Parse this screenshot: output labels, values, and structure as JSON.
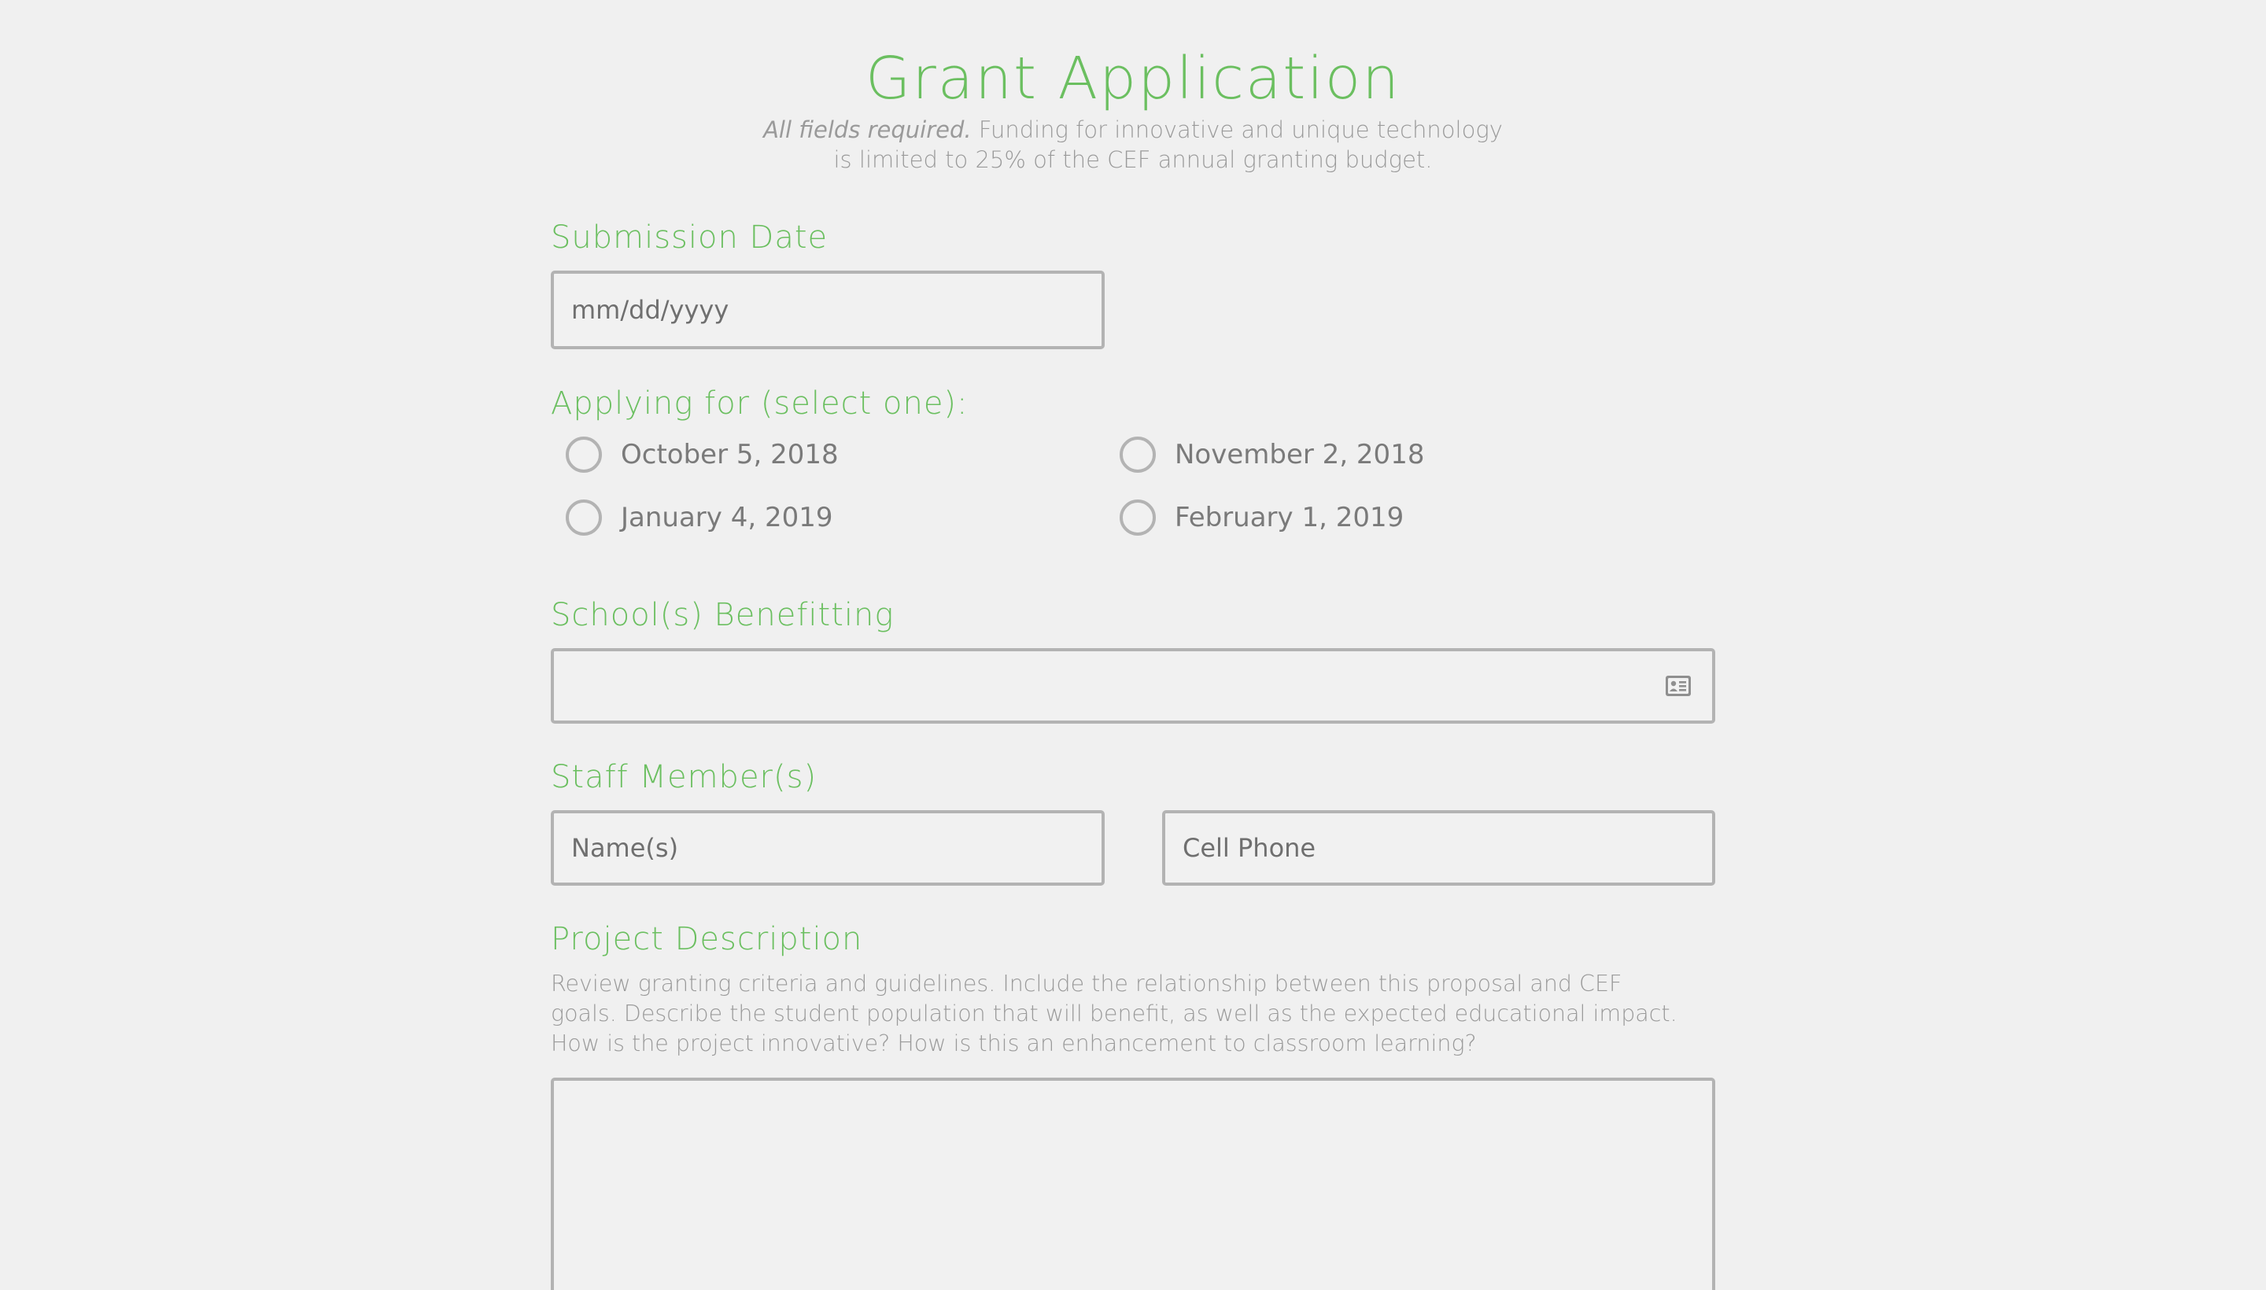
{
  "header": {
    "title": "Grant Application",
    "subtitle_required": "All fields required.",
    "subtitle_line1_rest": " Funding for innovative and unique technology",
    "subtitle_line2": "is limited to 25% of the CEF annual granting budget."
  },
  "submission_date": {
    "label": "Submission Date",
    "placeholder": "mm/dd/yyyy"
  },
  "applying_for": {
    "label": "Applying for (select one):",
    "options": [
      {
        "label": "October 5, 2018"
      },
      {
        "label": "November 2, 2018"
      },
      {
        "label": "January 4, 2019"
      },
      {
        "label": "February 1, 2019"
      }
    ]
  },
  "schools": {
    "label": "School(s) Benefitting",
    "icon": "contact-card-icon"
  },
  "staff": {
    "label": "Staff Member(s)",
    "name_placeholder": "Name(s)",
    "phone_placeholder": "Cell Phone"
  },
  "project": {
    "label": "Project Description",
    "help_line1": "Review granting criteria and guidelines. Include the relationship between this proposal and CEF",
    "help_line2": "goals. Describe the student population that will benefit, as well as the expected educational impact.",
    "help_line3": "How is the project innovative? How is this an enhancement to classroom learning?"
  },
  "colors": {
    "accent": "#6bbf60",
    "text_muted": "#9a9a9a",
    "border": "#b3b3b3",
    "background": "#f0f0f0"
  }
}
